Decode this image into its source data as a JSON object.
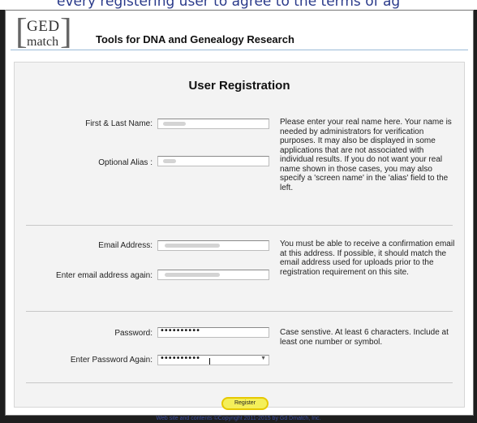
{
  "top_caption": "every registering user to agree to the terms of ag",
  "header": {
    "logo_line1": "GED",
    "logo_line2": "match",
    "tagline": "Tools for DNA and Genealogy Research"
  },
  "form": {
    "title": "User Registration",
    "name_section": {
      "first_last_label": "First & Last Name:",
      "alias_label": "Optional Alias :",
      "help": "Please enter your real name here. Your name is needed by administrators for verification purposes. It may also be displayed in some applications that are not associated with individual results. If you do not want your real name shown in those cases, you may also specify a 'screen name' in the 'alias' field to the left."
    },
    "email_section": {
      "email_label": "Email Address:",
      "email_again_label": "Enter email address again:",
      "help": "You must be able to receive a confirmation email at this address. If possible, it should match the email address used for uploads prior to the registration requirement on this site."
    },
    "password_section": {
      "password_label": "Password:",
      "password_value": "••••••••••",
      "password_again_label": "Enter Password Again:",
      "password_again_value": "••••••••••",
      "help": "Case senstive. At least 6 characters. Include at least one number or symbol."
    },
    "register_label": "Register"
  },
  "footer": "Web site and contents ©Copyright 2011-2015 by Gd Dmatch, Inc."
}
